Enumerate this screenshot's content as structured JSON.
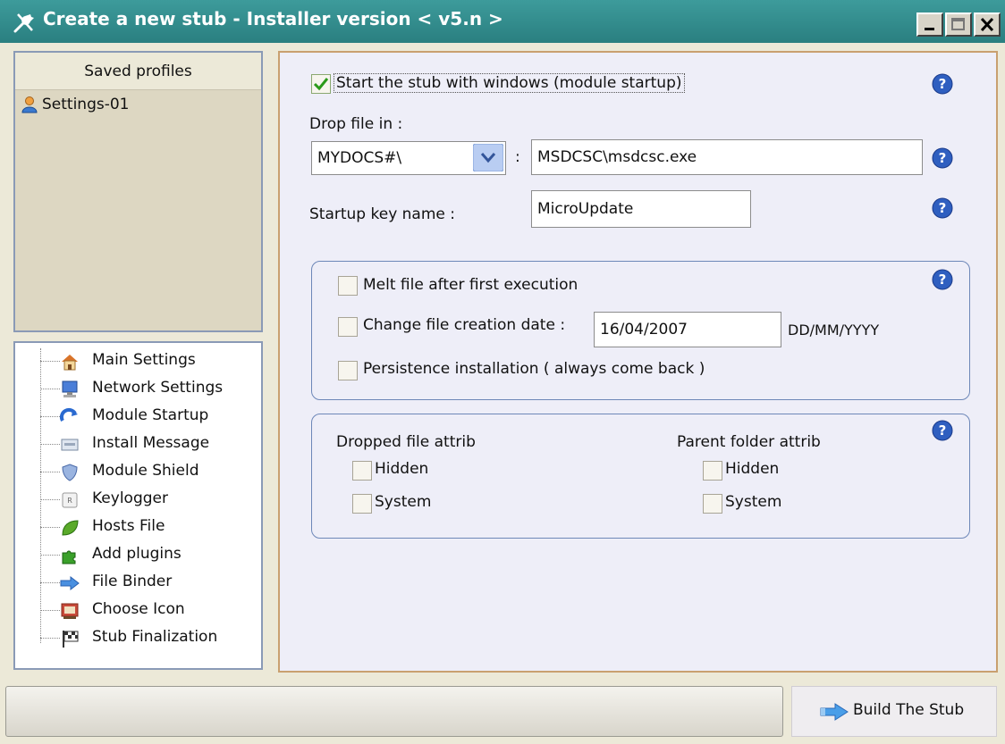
{
  "window": {
    "title": "Create a new stub - Installer version < v5.n >",
    "title_bar_color": "#2f8a8a"
  },
  "profiles": {
    "header": "Saved profiles",
    "items": [
      {
        "label": "Settings-01",
        "icon": "user-icon"
      }
    ]
  },
  "nav": {
    "items": [
      {
        "label": "Main Settings",
        "icon": "home-icon"
      },
      {
        "label": "Network Settings",
        "icon": "computer-icon"
      },
      {
        "label": "Module Startup",
        "icon": "refresh-icon"
      },
      {
        "label": "Install Message",
        "icon": "message-icon"
      },
      {
        "label": "Module Shield",
        "icon": "shield-icon"
      },
      {
        "label": "Keylogger",
        "icon": "key-icon"
      },
      {
        "label": "Hosts File",
        "icon": "leaf-icon"
      },
      {
        "label": "Add plugins",
        "icon": "puzzle-icon"
      },
      {
        "label": "File Binder",
        "icon": "arrow-icon"
      },
      {
        "label": "Choose Icon",
        "icon": "picture-icon"
      },
      {
        "label": "Stub Finalization",
        "icon": "flag-icon"
      }
    ]
  },
  "main": {
    "startup_checkbox": {
      "label": "Start the stub with windows (module startup)",
      "checked": true
    },
    "drop_label": "Drop file in :",
    "drop_select_value": "MYDOCS#\\",
    "colon": ":",
    "drop_path_value": "MSDCSC\\msdcsc.exe",
    "startup_key_label": "Startup key name :",
    "startup_key_value": "MicroUpdate",
    "options_group": {
      "melt": {
        "label": "Melt file after first execution",
        "checked": false
      },
      "change_date": {
        "label": "Change file creation date :",
        "checked": false
      },
      "date_value": "16/04/2007",
      "date_format": "DD/MM/YYYY",
      "persistence": {
        "label": "Persistence installation ( always come back )",
        "checked": false
      }
    },
    "attrib_group": {
      "dropped_title": "Dropped file attrib",
      "parent_title": "Parent folder attrib",
      "dropped_hidden": {
        "label": "Hidden",
        "checked": false
      },
      "dropped_system": {
        "label": "System",
        "checked": false
      },
      "parent_hidden": {
        "label": "Hidden",
        "checked": false
      },
      "parent_system": {
        "label": "System",
        "checked": false
      }
    }
  },
  "footer": {
    "build_button": "Build The Stub"
  }
}
